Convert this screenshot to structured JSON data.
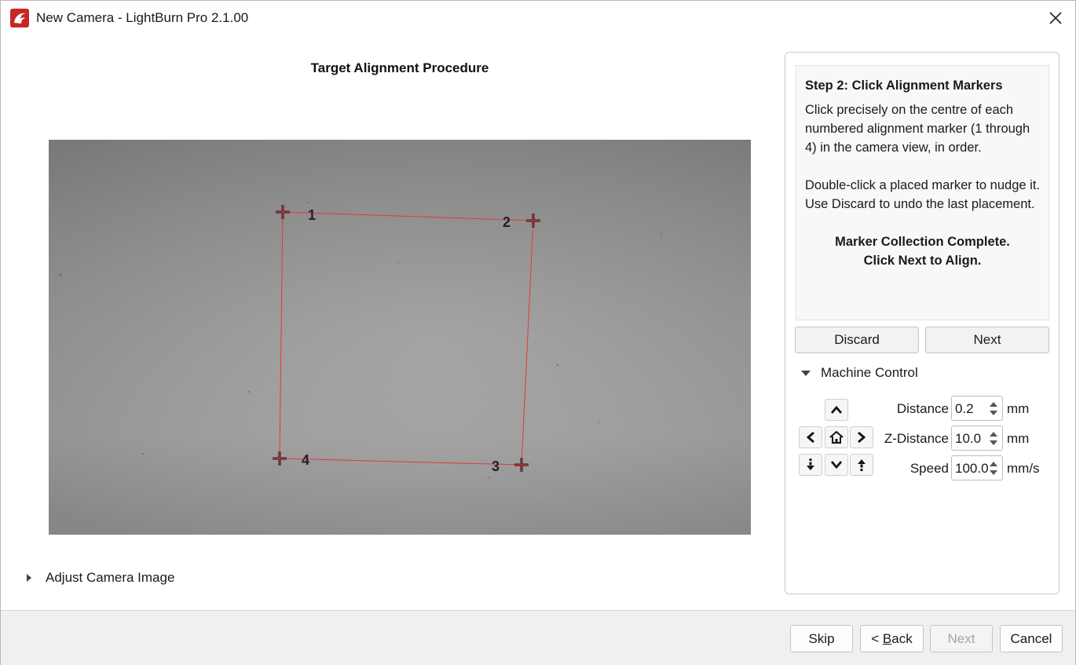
{
  "window": {
    "title": "New Camera - LightBurn Pro 2.1.00",
    "close_label": "×"
  },
  "main": {
    "procedure_title": "Target Alignment Procedure",
    "markers": [
      "1",
      "2",
      "3",
      "4"
    ],
    "adjust_camera_label": "Adjust Camera Image"
  },
  "panel": {
    "step_title": "Step 2: Click Alignment Markers",
    "instruction_1": "Click precisely on the centre of each numbered alignment marker (1 through 4) in the camera view, in order.",
    "instruction_2": "Double-click a placed marker to nudge it. Use Discard to undo the last placement.",
    "complete_line_1": "Marker Collection Complete.",
    "complete_line_2": "Click Next to Align.",
    "discard_label": "Discard",
    "next_label": "Next",
    "machine_control_label": "Machine Control",
    "distance_label": "Distance",
    "distance_value": "0.2",
    "distance_unit": "mm",
    "z_distance_label": "Z-Distance",
    "z_distance_value": "10.0",
    "z_distance_unit": "mm",
    "speed_label": "Speed",
    "speed_value": "100.0",
    "speed_unit": "mm/s"
  },
  "footer": {
    "skip_label": "Skip",
    "back_prefix": "< ",
    "back_underlined": "B",
    "back_rest": "ack",
    "next_label": "Next",
    "cancel_label": "Cancel"
  },
  "colors": {
    "marker_line": "#e0393e",
    "accent": "#c62828"
  },
  "icons": [
    "lightburn-app-icon",
    "close-icon",
    "chevron-up-icon",
    "chevron-down-icon",
    "chevron-left-icon",
    "chevron-right-icon",
    "home-icon",
    "z-down-icon",
    "z-up-icon"
  ]
}
